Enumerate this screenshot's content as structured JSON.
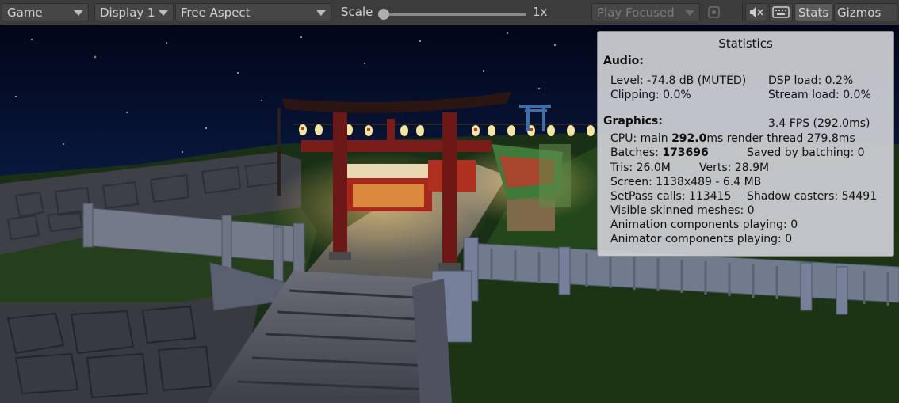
{
  "toolbar": {
    "view_select": "Game",
    "display_select": "Display 1",
    "aspect_select": "Free Aspect",
    "scale_label": "Scale",
    "scale_value_text": "1x",
    "scale_level": 0,
    "play_mode_select": "Play Focused",
    "stats_button": "Stats",
    "gizmos_button": "Gizmos"
  },
  "stats": {
    "title": "Statistics",
    "audio": {
      "heading": "Audio:",
      "level": "Level: -74.8 dB (MUTED)",
      "dsp_load": "DSP load: 0.2%",
      "clipping": "Clipping: 0.0%",
      "stream_load": "Stream load: 0.0%"
    },
    "graphics": {
      "heading": "Graphics:",
      "fps": "3.4 FPS (292.0ms)",
      "cpu_prefix": "CPU: main ",
      "cpu_main": "292.0",
      "cpu_suffix": "ms  render thread 279.8ms",
      "batches_prefix": "Batches: ",
      "batches_value": "173696",
      "saved_by_batching": "Saved by batching: 0",
      "tris": "Tris: 26.0M",
      "verts": "Verts: 28.9M",
      "screen": "Screen: 1138x489 - 6.4 MB",
      "setpass": "SetPass calls: 113415",
      "shadow_casters": "Shadow casters: 54491",
      "visible_skinned": "Visible skinned meshes: 0",
      "animation_components": "Animation components playing: 0",
      "animator_components": "Animator components playing: 0"
    }
  },
  "icons": {
    "audio_mute": "audio-mute-icon",
    "keyboard": "keyboard-icon",
    "maximize": "maximize-icon"
  },
  "colors": {
    "sky_top": "#02061a",
    "sky_horizon": "#16356b",
    "torii": "#6b1816",
    "grass": "#1d3616",
    "stone": "#4a4a55"
  }
}
